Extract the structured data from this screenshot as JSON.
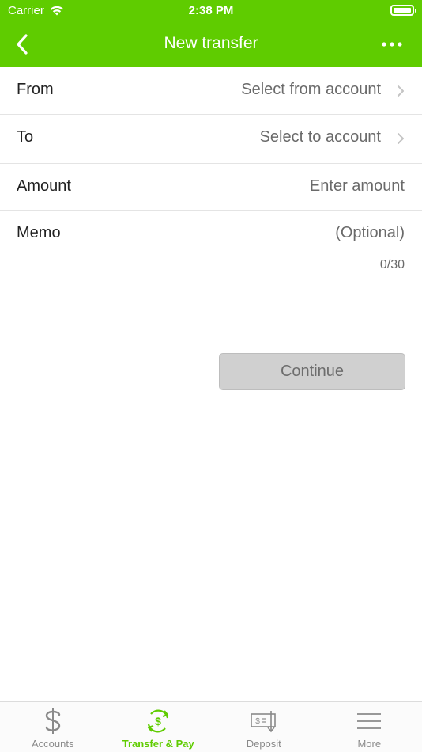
{
  "status_bar": {
    "carrier": "Carrier",
    "time": "2:38 PM"
  },
  "nav": {
    "title": "New transfer",
    "back_icon": "chevron-left-icon",
    "more_icon": "ellipsis-icon"
  },
  "form": {
    "from": {
      "label": "From",
      "placeholder": "Select from account"
    },
    "to": {
      "label": "To",
      "placeholder": "Select to account"
    },
    "amount": {
      "label": "Amount",
      "placeholder": "Enter amount"
    },
    "memo": {
      "label": "Memo",
      "placeholder": "(Optional)",
      "counter": "0/30"
    }
  },
  "continue_label": "Continue",
  "tabs": [
    {
      "label": "Accounts",
      "icon": "dollar-icon",
      "active": false
    },
    {
      "label": "Transfer & Pay",
      "icon": "transfer-icon",
      "active": true
    },
    {
      "label": "Deposit",
      "icon": "check-deposit-icon",
      "active": false
    },
    {
      "label": "More",
      "icon": "menu-icon",
      "active": false
    }
  ],
  "colors": {
    "brand": "#5fcc00",
    "disabled_button": "#d0d0d0",
    "inactive_tab": "#8a8a8a"
  }
}
